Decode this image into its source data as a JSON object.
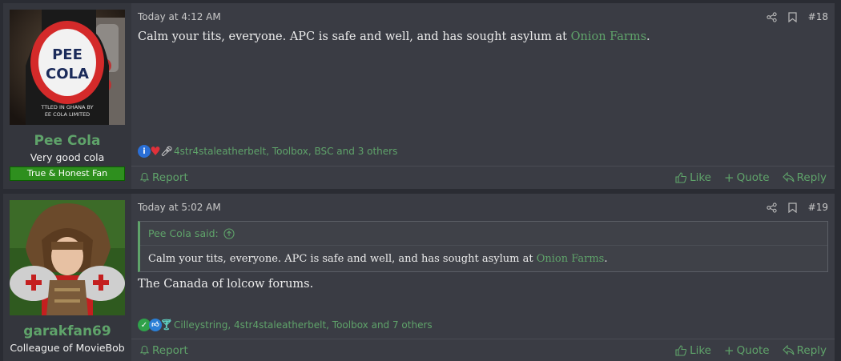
{
  "posts": [
    {
      "username": "Pee Cola",
      "user_title": "Very good cola",
      "user_banner": "True & Honest Fan",
      "timestamp": "Today at 4:12 AM",
      "post_number": "#18",
      "body_text": "Calm your tits, everyone. APC is safe and well, and has sought asylum at ",
      "body_link": "Onion Farms",
      "body_suffix": ".",
      "reaction_users": "4str4staleatherbelt, Toolbox, BSC and 3 others",
      "reaction_icons": [
        "informative-icon",
        "heart-icon",
        "microphone-icon"
      ],
      "avatar_text": [
        "PEE",
        "COLA",
        "TTLED IN GHANA BY",
        "EE COLA LIMITED"
      ]
    },
    {
      "username": "garakfan69",
      "user_title": "Colleague of MovieBob",
      "timestamp": "Today at 5:02 AM",
      "post_number": "#19",
      "quote_author": "Pee Cola said:",
      "quote_text": "Calm your tits, everyone. APC is safe and well, and has sought asylum at ",
      "quote_link": "Onion Farms",
      "quote_suffix": ".",
      "body_text": "The Canada of lolcow forums.",
      "reaction_users": "Cilleystring, 4str4staleatherbelt, Toolbox and 7 others",
      "reaction_icons": [
        "agree-icon",
        "like-icon",
        "cocktail-icon"
      ]
    }
  ],
  "actions": {
    "report": "Report",
    "like": "Like",
    "quote": "Quote",
    "reply": "Reply"
  },
  "colors": {
    "accent": "#5fa36a",
    "post_bg": "#3a3c44",
    "banner_bg": "#2e8f1e"
  }
}
